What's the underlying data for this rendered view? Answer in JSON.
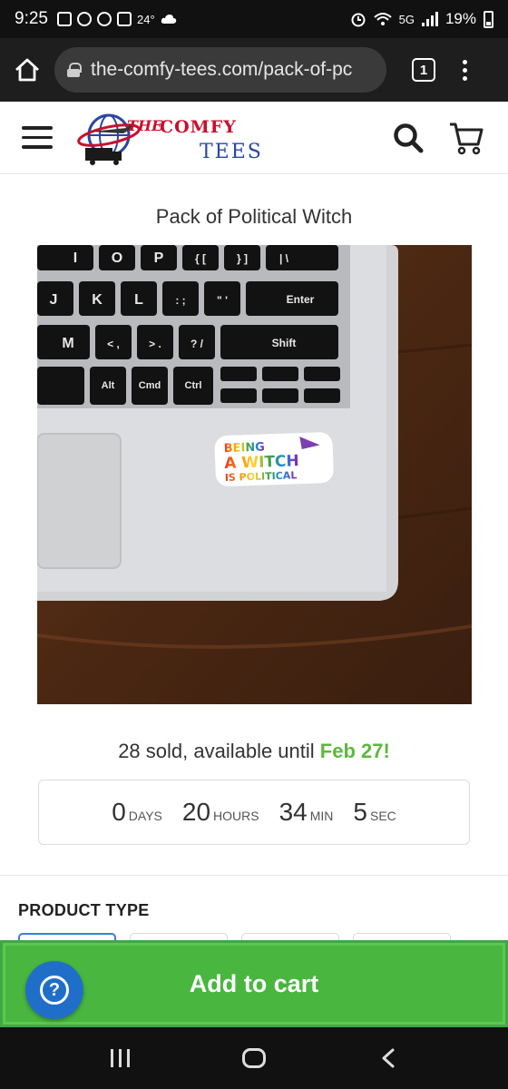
{
  "status_bar": {
    "time": "9:25",
    "temperature": "24°",
    "network": "5G",
    "battery": "19%"
  },
  "browser": {
    "url": "the-comfy-tees.com/pack-of-pc",
    "tab_count": "1"
  },
  "site": {
    "logo_the": "THE",
    "logo_comfy": "COMFY",
    "logo_tees": "TEES"
  },
  "product": {
    "title": "Pack of Political Witch",
    "sticker_lines": [
      "BEING",
      "A WITCH",
      "IS POLITICAL"
    ],
    "sold_text": "28 sold, available until ",
    "sold_date": "Feb 27!",
    "countdown": {
      "days": "0",
      "days_label": "DAYS",
      "hours": "20",
      "hours_label": "HOURS",
      "min": "34",
      "min_label": "MIN",
      "sec": "5",
      "sec_label": "SEC"
    },
    "section_label": "PRODUCT TYPE"
  },
  "keyboard": {
    "row1": [
      "I",
      "O",
      "P",
      "{ [",
      "} ]",
      "| \\"
    ],
    "row2": [
      "J",
      "K",
      "L",
      ": ;",
      "\" '",
      "Enter"
    ],
    "row3": [
      "M",
      "< ,",
      "> .",
      "? /",
      "Shift"
    ],
    "row4": [
      "Alt",
      "Cmd",
      "Ctrl"
    ]
  },
  "cart": {
    "add_label": "Add to cart"
  },
  "colors": {
    "accent_green": "#5db83e",
    "cart_green": "#49b63f",
    "help_blue": "#1f6fc9"
  }
}
